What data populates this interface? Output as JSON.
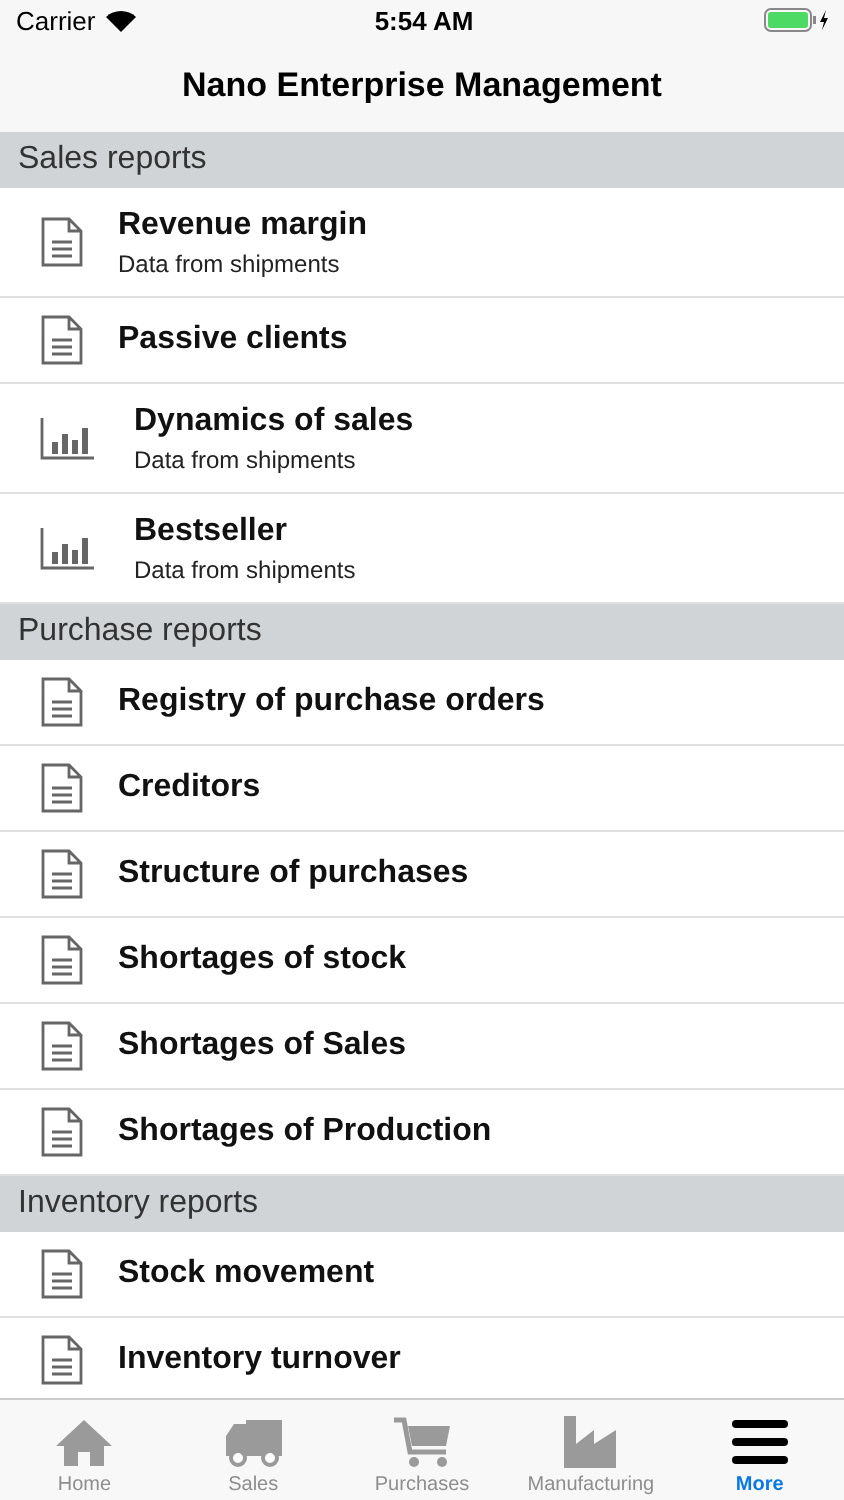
{
  "status_bar": {
    "carrier": "Carrier",
    "time": "5:54 AM"
  },
  "nav_bar": {
    "title": "Nano Enterprise Management"
  },
  "sections": [
    {
      "title": "Sales reports",
      "items": [
        {
          "kind": "document",
          "title": "Revenue margin",
          "subtitle": "Data from shipments"
        },
        {
          "kind": "document",
          "title": "Passive clients"
        },
        {
          "kind": "chart",
          "title": "Dynamics of sales",
          "subtitle": "Data from shipments"
        },
        {
          "kind": "chart",
          "title": "Bestseller",
          "subtitle": "Data from shipments"
        }
      ]
    },
    {
      "title": "Purchase reports",
      "items": [
        {
          "kind": "document",
          "title": "Registry of purchase orders"
        },
        {
          "kind": "document",
          "title": "Creditors"
        },
        {
          "kind": "document",
          "title": "Structure of purchases"
        },
        {
          "kind": "document",
          "title": "Shortages of stock"
        },
        {
          "kind": "document",
          "title": "Shortages of Sales"
        },
        {
          "kind": "document",
          "title": "Shortages of Production"
        }
      ]
    },
    {
      "title": "Inventory reports",
      "items": [
        {
          "kind": "document",
          "title": "Stock movement"
        },
        {
          "kind": "document",
          "title": "Inventory turnover"
        }
      ]
    }
  ],
  "tab_bar": [
    {
      "kind": "home",
      "label": "Home",
      "selected": false
    },
    {
      "kind": "truck",
      "label": "Sales",
      "selected": false
    },
    {
      "kind": "cart",
      "label": "Purchases",
      "selected": false
    },
    {
      "kind": "factory",
      "label": "Manufacturing",
      "selected": false
    },
    {
      "kind": "menu",
      "label": "More",
      "selected": true
    }
  ]
}
